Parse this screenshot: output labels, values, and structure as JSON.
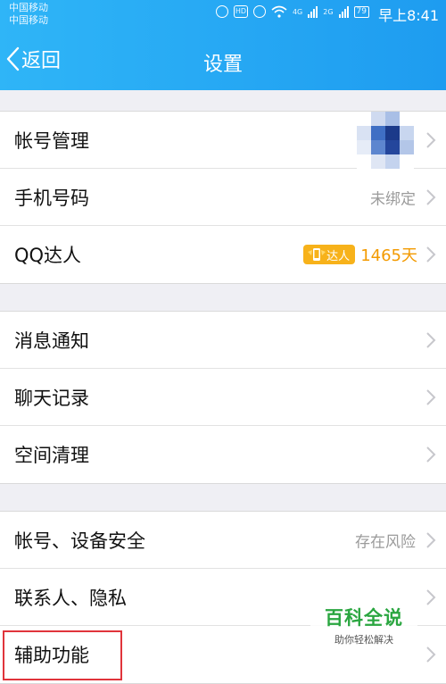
{
  "status_bar": {
    "carrier_1": "中国移动",
    "carrier_2": "中国移动",
    "network_4g": "4G",
    "network_2g": "2G",
    "hd_label": "HD",
    "battery": "79",
    "time": "早上8:41"
  },
  "nav": {
    "back_label": "返回",
    "title": "设置"
  },
  "group1": [
    {
      "label": "帐号管理",
      "value": ""
    },
    {
      "label": "手机号码",
      "value": "未绑定"
    },
    {
      "label": "QQ达人",
      "badge": "达人",
      "days": "1465天"
    }
  ],
  "group2": [
    {
      "label": "消息通知"
    },
    {
      "label": "聊天记录"
    },
    {
      "label": "空间清理"
    }
  ],
  "group3": [
    {
      "label": "帐号、设备安全",
      "value": "存在风险"
    },
    {
      "label": "联系人、隐私"
    },
    {
      "label": "辅助功能"
    }
  ],
  "watermark": {
    "title": "百科全说",
    "subtitle": "助你轻松解决"
  },
  "colors": {
    "header": "#1e9cf0",
    "badge": "#f7b21a",
    "highlight": "#e0343b",
    "watermark": "#2aa640"
  }
}
